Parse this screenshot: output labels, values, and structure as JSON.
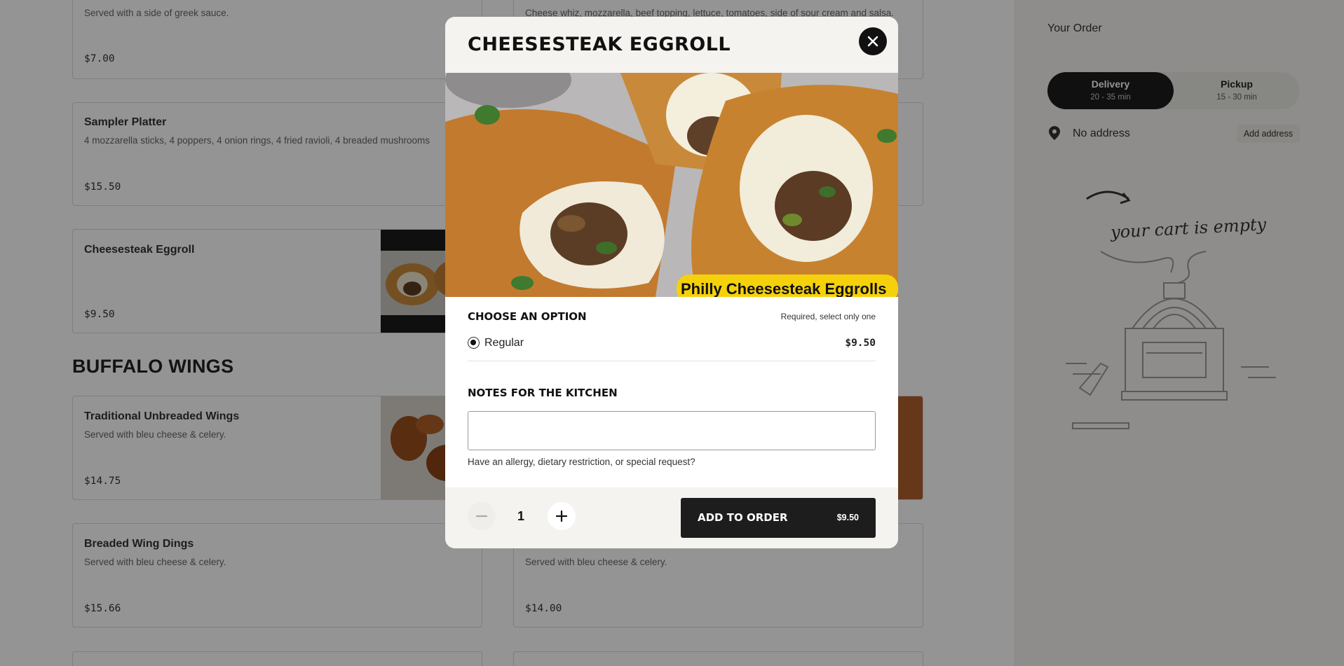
{
  "menu": {
    "cards": [
      {
        "name": "",
        "description": "Served with a side of greek sauce.",
        "price": "$7.00"
      },
      {
        "name": "",
        "description": "Cheese whiz, mozzarella, beef topping, lettuce, tomatoes, side of sour cream and salsa.",
        "price": ""
      },
      {
        "name": "Sampler Platter",
        "description": "4 mozzarella sticks, 4 poppers, 4 onion rings, 4 fried ravioli, 4 breaded mushrooms",
        "price": "$15.50"
      },
      {
        "name": "Cheesesteak Eggroll",
        "description": "",
        "price": "$9.50"
      },
      {
        "name": "Traditional Unbreaded Wings",
        "description": "Served with bleu cheese & celery.",
        "price": "$14.75"
      },
      {
        "name": "Breaded Wing Dings",
        "description": "Served with bleu cheese & celery.",
        "price": "$15.66"
      },
      {
        "name": "",
        "description": "Served with bleu cheese & celery.",
        "price": "$14.00"
      }
    ],
    "section_title": "BUFFALO WINGS"
  },
  "sidebar": {
    "title": "Your Order",
    "modes": [
      {
        "label": "Delivery",
        "time": "20 - 35 min"
      },
      {
        "label": "Pickup",
        "time": "15 - 30 min"
      }
    ],
    "address": "No address",
    "add_address": "Add address",
    "empty_text": "your cart is empty"
  },
  "modal": {
    "title": "CHEESESTEAK EGGROLL",
    "hero_caption": "Philly Cheesesteak Eggrolls",
    "options_title": "CHOOSE AN OPTION",
    "options_requirement": "Required, select only one",
    "option": {
      "label": "Regular",
      "price": "$9.50"
    },
    "notes_title": "NOTES FOR THE KITCHEN",
    "notes_value": "",
    "notes_hint": "Have an allergy, dietary restriction, or special request?",
    "quantity": "1",
    "add_label": "ADD TO ORDER",
    "add_price": "$9.50"
  },
  "colors": {
    "accent": "#1d1d1d",
    "panel": "#f4f3ef",
    "caption_yellow": "#f5d10c"
  }
}
